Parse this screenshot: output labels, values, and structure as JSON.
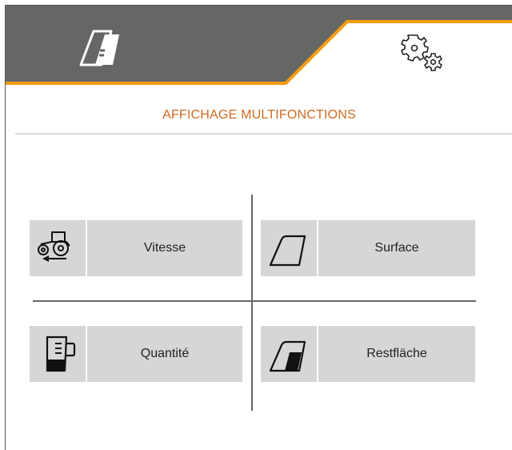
{
  "tabs": [
    {
      "icon": "field-icon",
      "state": "inactive"
    },
    {
      "icon": "gears-icon",
      "state": "active"
    }
  ],
  "colors": {
    "accent": "#f39c12",
    "title": "#d2691e",
    "tabbar": "#666666",
    "tile": "#d6d6d6"
  },
  "page": {
    "title": "AFFICHAGE MULTIFONCTIONS"
  },
  "tiles": [
    {
      "label": "Vitesse",
      "icon": "tractor-icon"
    },
    {
      "label": "Surface",
      "icon": "area-icon"
    },
    {
      "label": "Quantité",
      "icon": "hopper-icon"
    },
    {
      "label": "Restfläche",
      "icon": "remaining-area-icon"
    }
  ]
}
